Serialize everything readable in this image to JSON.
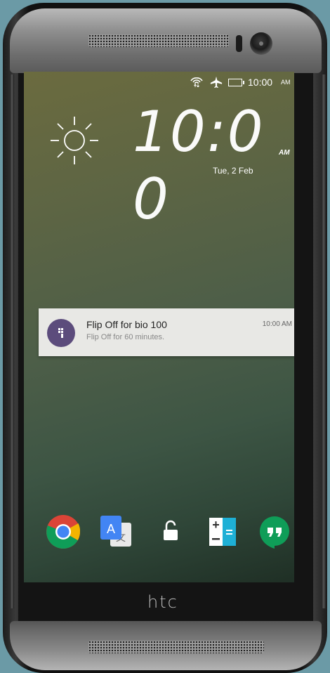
{
  "device": {
    "brand": "htc"
  },
  "status_bar": {
    "time": "10:00",
    "ampm": "AM",
    "icons": [
      "wifi-icon",
      "airplane-mode-icon",
      "battery-icon"
    ]
  },
  "lockscreen": {
    "weather_icon": "sun-icon",
    "clock_digits": [
      "1",
      "0",
      ":",
      "0",
      "0"
    ],
    "clock_ampm": "AM",
    "date": "Tue, 2 Feb"
  },
  "notification": {
    "title": "Flip Off for bio 100",
    "body": "Flip Off for 60 minutes.",
    "time": "10:00 AM",
    "icon": "flip-off-app-icon",
    "icon_color": "#5c4c7c"
  },
  "dock": {
    "items": [
      {
        "icon": "chrome-icon"
      },
      {
        "icon": "google-translate-icon"
      },
      {
        "icon": "unlock-icon"
      },
      {
        "icon": "calculator-icon"
      },
      {
        "icon": "hangouts-icon"
      }
    ]
  }
}
